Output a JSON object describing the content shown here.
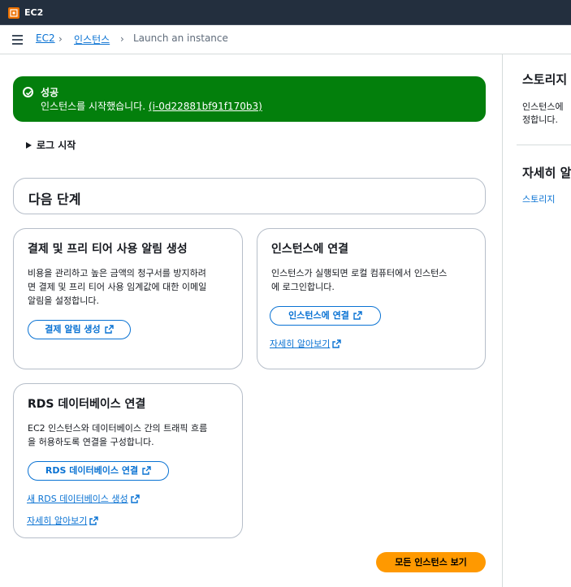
{
  "topbar": {
    "service_name": "EC2"
  },
  "breadcrumb": {
    "items": [
      "EC2",
      "인스턴스",
      "Launch an instance"
    ]
  },
  "flash": {
    "title": "성공",
    "message": "인스턴스를 시작했습니다.",
    "instance_id": "(i-0d22881bf91f170b3)"
  },
  "log": {
    "label": "로그 시작"
  },
  "next_steps": {
    "heading": "다음 단계"
  },
  "cards": {
    "billing": {
      "title": "결제 및 프리 티어 사용 알림 생성",
      "desc_lines": [
        "비용을 관리하고 높은 금액의 청구서를 방지하려",
        "면 결제 및 프리 티어 사용 임계값에 대한 이메일",
        "알림을 설정합니다."
      ],
      "button": "결제 알림 생성"
    },
    "connect": {
      "title": "인스턴스에 연결",
      "desc_lines": [
        "인스턴스가 실행되면 로컬 컴퓨터에서 인스턴스",
        "에 로그인합니다."
      ],
      "button": "인스턴스에 연결",
      "link": "자세히 알아보기"
    },
    "rds": {
      "title": "RDS 데이터베이스 연결",
      "desc_lines": [
        "EC2 인스턴스와 데이터베이스 간의 트래픽 흐름",
        "을 허용하도록 연결을 구성합니다."
      ],
      "button": "RDS 데이터베이스 연결",
      "link_new": "새 RDS 데이터베이스 생성",
      "link_learn": "자세히 알아보기"
    }
  },
  "primary_button": "모든 인스턴스 보기",
  "right_panel": {
    "title": "스토리지",
    "text_lines": [
      "인스턴스에",
      "정합니다."
    ],
    "title2": "자세히 알",
    "link": "스토리지"
  },
  "colors": {
    "success": "#037f0c",
    "link": "#0972d3",
    "primary": "#ff9900",
    "topbar": "#232f3e"
  }
}
